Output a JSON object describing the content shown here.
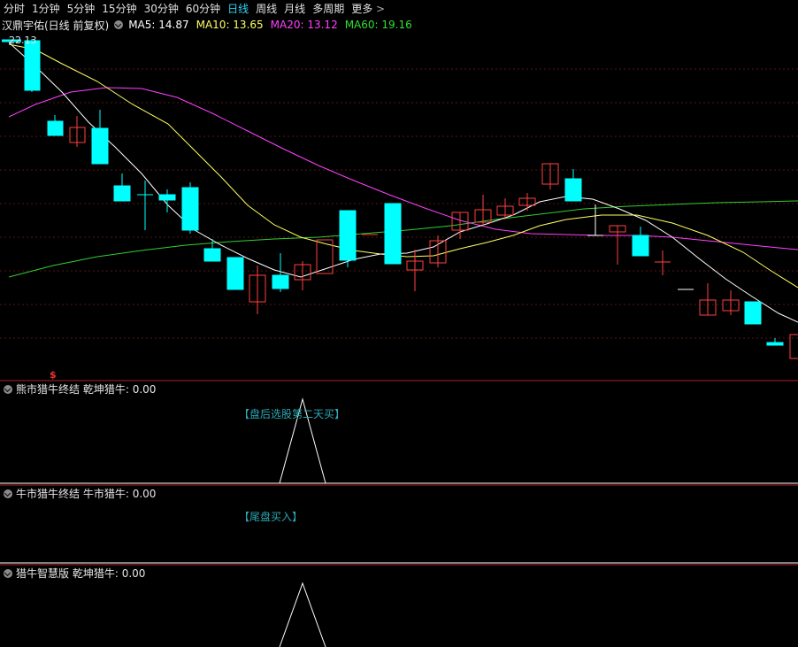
{
  "tabs": [
    {
      "label": "分时",
      "active": false
    },
    {
      "label": "1分钟",
      "active": false
    },
    {
      "label": "5分钟",
      "active": false
    },
    {
      "label": "15分钟",
      "active": false
    },
    {
      "label": "30分钟",
      "active": false
    },
    {
      "label": "60分钟",
      "active": false
    },
    {
      "label": "日线",
      "active": true
    },
    {
      "label": "周线",
      "active": false
    },
    {
      "label": "月线",
      "active": false
    },
    {
      "label": "多周期",
      "active": false
    },
    {
      "label": "更多",
      "active": false
    }
  ],
  "stock": {
    "name": "汉鼎宇佑(日线 前复权)"
  },
  "ma": [
    {
      "label": "MA5: 14.87",
      "color": "#ffffff"
    },
    {
      "label": "MA10: 13.65",
      "color": "#ffff60"
    },
    {
      "label": "MA20: 13.12",
      "color": "#ff40ff"
    },
    {
      "label": "MA60: 19.16",
      "color": "#30e030"
    }
  ],
  "main_chart": {
    "high_price_label": "22.13",
    "marker_symbol": "$"
  },
  "panels": [
    {
      "title": "熊市猎牛终结",
      "subtitle": "乾坤猎牛: 0.00",
      "signal": "【盘后选股第二天买】"
    },
    {
      "title": "牛市猎牛终结",
      "subtitle": "牛市猎牛: 0.00",
      "signal": "【尾盘买入】"
    },
    {
      "title": "猎牛智慧版",
      "subtitle": "乾坤猎牛: 0.00",
      "signal": ""
    }
  ],
  "colors": {
    "up": "#ff4040",
    "down": "#00ffff",
    "grid": "#7a1a1a",
    "axis": "#b02020"
  }
}
